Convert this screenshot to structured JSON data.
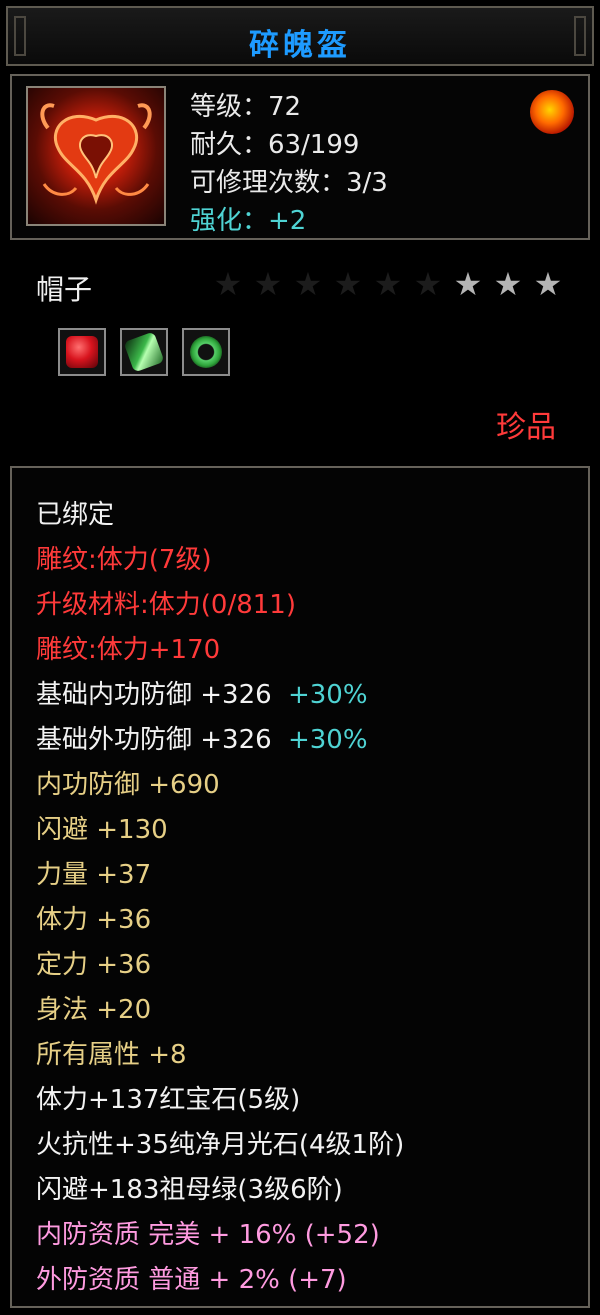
{
  "window": {
    "title": "碎魄盔"
  },
  "item": {
    "level": "等级：72",
    "durability": "耐久：63/199",
    "repair_count": "可修理次数：3/3",
    "enhance": "强化：+2",
    "type": "帽子",
    "rarity": "珍品",
    "stars": {
      "total": 9,
      "lit": 3
    }
  },
  "colors": {
    "title": "#1e9bff",
    "red_text": "#ff3a3a",
    "gold_text": "#e6cf86",
    "pink_text": "#ff9be0",
    "cyan_text": "#4fd3d3"
  },
  "gems": [
    {
      "name": "ruby-gem-icon",
      "color": "#d8141e"
    },
    {
      "name": "emerald-gem-icon",
      "color": "#3cb84a"
    },
    {
      "name": "moonstone-ring-icon",
      "color": "#2ea43a"
    }
  ],
  "attributes": {
    "bound": "已绑定",
    "engrave": "雕纹:体力(7级)",
    "upgrade_material": "升级材料:体力(0/811)",
    "engrave_bonus": "雕纹:体力+170",
    "base_inner_def": "基础内功防御 +326",
    "base_inner_def_pct": "+30%",
    "base_outer_def": "基础外功防御 +326",
    "base_outer_def_pct": "+30%",
    "inner_def": "内功防御 +690",
    "dodge": "闪避 +130",
    "strength": "力量 +37",
    "stamina": "体力 +36",
    "focus": "定力 +36",
    "agility": "身法 +20",
    "all_attrs": "所有属性 +8",
    "gem1": "体力+137红宝石(5级)",
    "gem2": "火抗性+35纯净月光石(4级1阶)",
    "gem3": "闪避+183祖母绿(3级6阶)",
    "inner_quality": "内防资质 完美 + 16% (+52)",
    "outer_quality": "外防资质 普通 + 2% (+7)"
  }
}
